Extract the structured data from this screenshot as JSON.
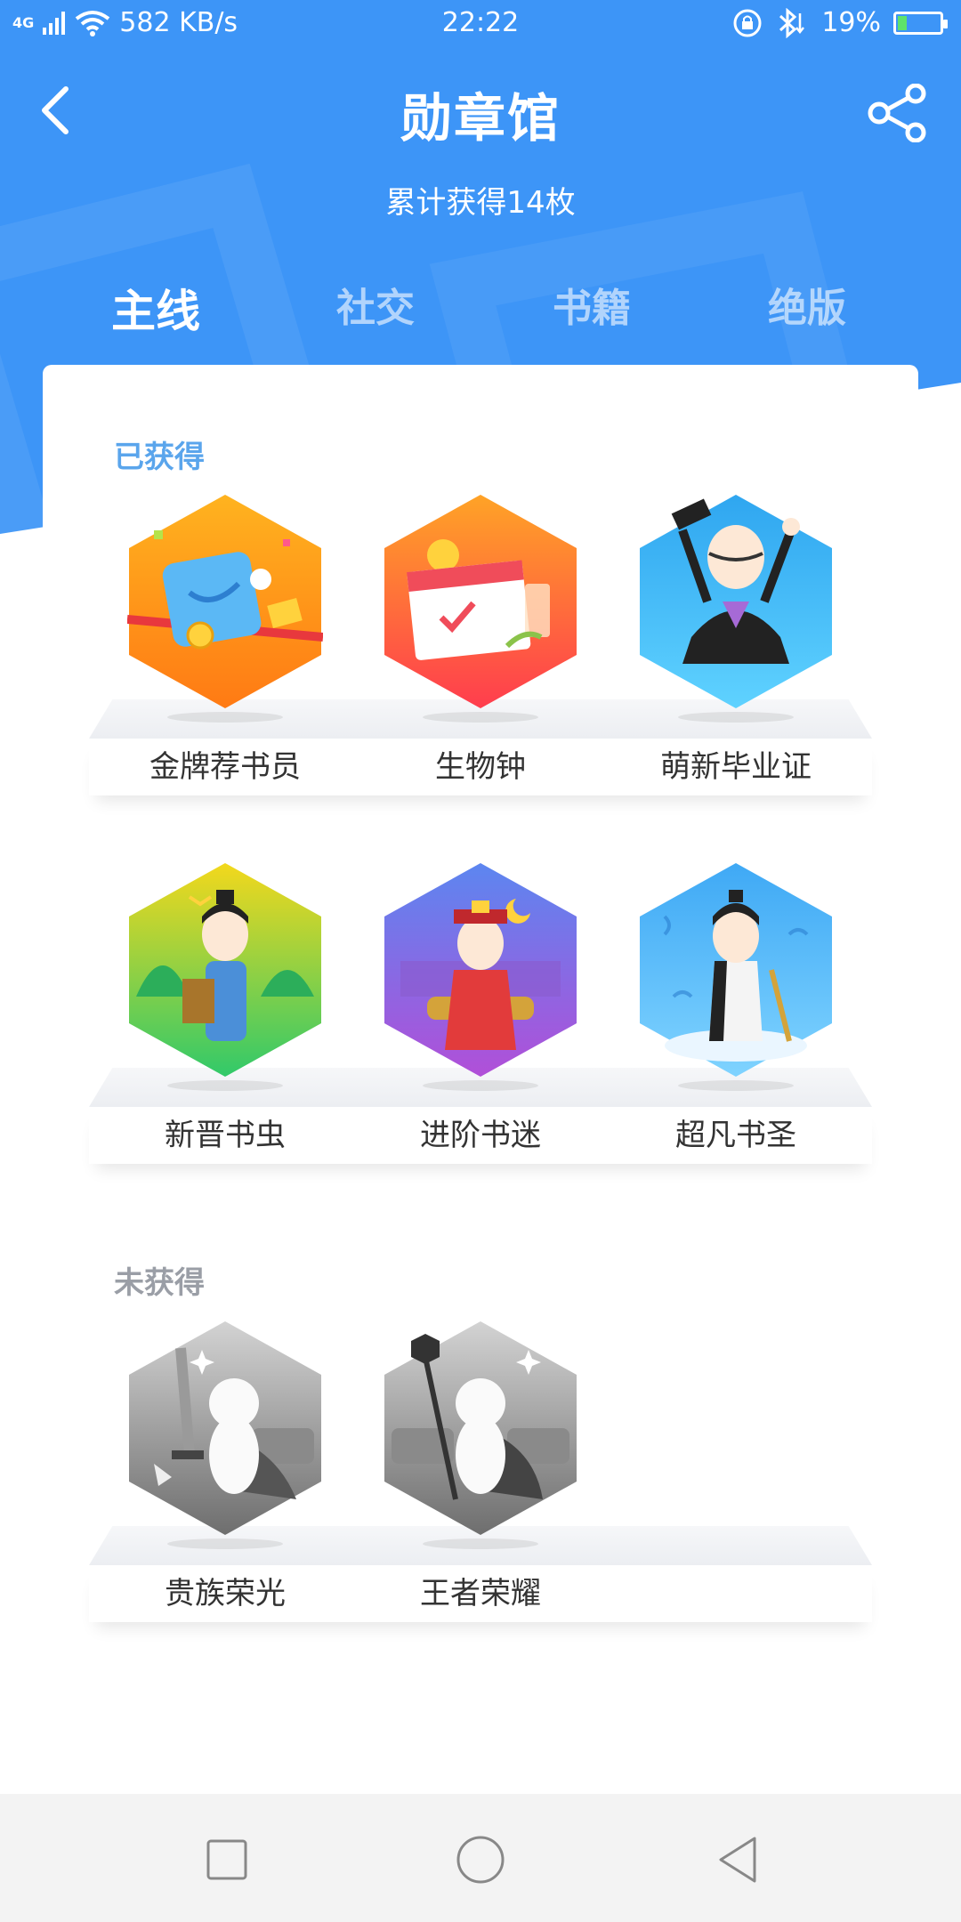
{
  "status_bar": {
    "network": "4G",
    "speed": "582 KB/s",
    "time": "22:22",
    "battery": "19%",
    "battery_level": 0.19
  },
  "header": {
    "title": "勋章馆",
    "subtitle": "累计获得14枚",
    "tabs": [
      {
        "label": "主线",
        "active": true
      },
      {
        "label": "社交",
        "active": false
      },
      {
        "label": "书籍",
        "active": false
      },
      {
        "label": "绝版",
        "active": false
      }
    ]
  },
  "sections": {
    "obtained": {
      "title": "已获得",
      "badges": [
        {
          "name": "金牌荐书员",
          "icon": "gold-medal-recommender-icon"
        },
        {
          "name": "生物钟",
          "icon": "calendar-clock-icon"
        },
        {
          "name": "萌新毕业证",
          "icon": "graduate-icon"
        },
        {
          "name": "新晋书虫",
          "icon": "scholar-bookworm-icon"
        },
        {
          "name": "进阶书迷",
          "icon": "scholar-official-icon"
        },
        {
          "name": "超凡书圣",
          "icon": "sage-scholar-icon"
        }
      ]
    },
    "not_obtained": {
      "title": "未获得",
      "badges": [
        {
          "name": "贵族荣光",
          "icon": "noble-sword-icon"
        },
        {
          "name": "王者荣耀",
          "icon": "king-scepter-icon"
        }
      ]
    }
  },
  "colors": {
    "header_blue": "#3d95f7",
    "section_obtained": "#5aa5ec",
    "section_not_obtained": "#9a9ea6"
  }
}
